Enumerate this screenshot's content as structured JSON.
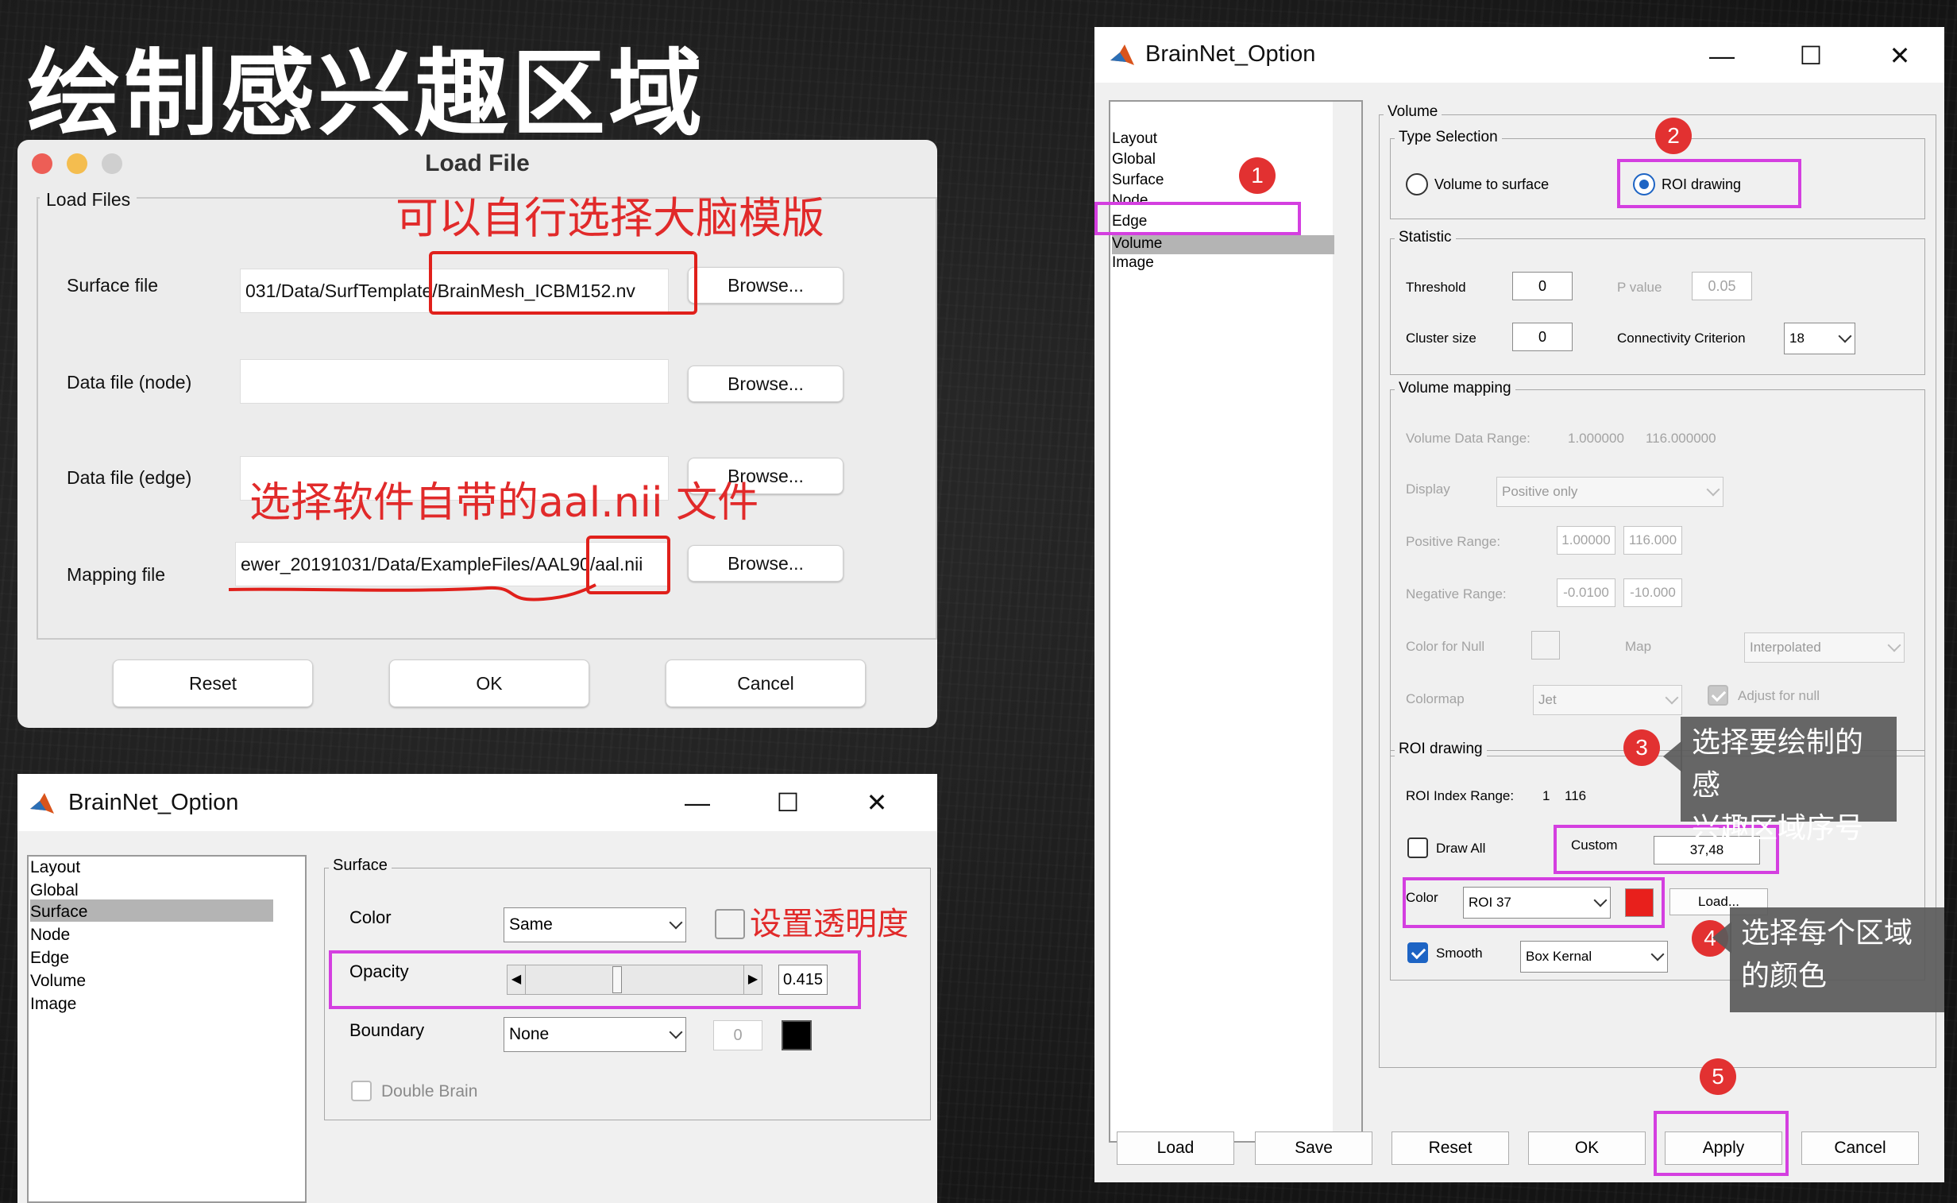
{
  "heading": "绘制感兴趣区域",
  "load_file": {
    "title": "Load File",
    "group": "Load Files",
    "rows": [
      {
        "label": "Surface file",
        "value": "031/Data/SurfTemplate/BrainMesh_ICBM152.nv",
        "button": "Browse..."
      },
      {
        "label": "Data file (node)",
        "value": "",
        "button": "Browse..."
      },
      {
        "label": "Data file (edge)",
        "value": "",
        "button": "Browse..."
      },
      {
        "label": "Mapping file",
        "value": "ewer_20191031/Data/ExampleFiles/AAL90/aal.nii",
        "button": "Browse..."
      }
    ],
    "buttons": {
      "reset": "Reset",
      "ok": "OK",
      "cancel": "Cancel"
    },
    "annotations": {
      "template": "可以自行选择大脑模版",
      "aal": "选择软件自带的aal.nii 文件"
    }
  },
  "option_small": {
    "title": "BrainNet_Option",
    "list": [
      "Layout",
      "Global",
      "Surface",
      "Node",
      "Edge",
      "Volume",
      "Image"
    ],
    "selected": "Surface",
    "panel": "Surface",
    "color_label": "Color",
    "color_value": "Same",
    "opacity_label": "Opacity",
    "opacity_value": "0.415",
    "opacity_fraction": 0.415,
    "boundary_label": "Boundary",
    "boundary_value": "None",
    "boundary_num": "0",
    "double_brain": "Double Brain",
    "annotation": "设置透明度"
  },
  "option_large": {
    "title": "BrainNet_Option",
    "list": [
      "Layout",
      "Global",
      "Surface",
      "Node",
      "Edge",
      "Volume",
      "Image"
    ],
    "selected": "Volume",
    "volume_label": "Volume",
    "type_selection": "Type Selection",
    "radio_surface": "Volume to surface",
    "radio_roi": "ROI drawing",
    "statistic": "Statistic",
    "threshold_label": "Threshold",
    "threshold_value": "0",
    "pvalue_label": "P value",
    "pvalue_value": "0.05",
    "cluster_label": "Cluster size",
    "cluster_value": "0",
    "connectivity_label": "Connectivity Criterion",
    "connectivity_value": "18",
    "volume_mapping": "Volume mapping",
    "data_range_label": "Volume Data Range:",
    "data_range_min": "1.000000",
    "data_range_max": "116.000000",
    "display_label": "Display",
    "display_value": "Positive only",
    "positive_label": "Positive Range:",
    "positive_min": "1.00000",
    "positive_max": "116.000",
    "negative_label": "Negative Range:",
    "negative_min": "-0.0100",
    "negative_max": "-10.000",
    "null_color_label": "Color for Null",
    "map_label": "Map",
    "map_value": "Interpolated",
    "colormap_label": "Colormap",
    "colormap_value": "Jet",
    "adjust_label": "Adjust for null",
    "roi_drawing": "ROI drawing",
    "roi_range_label": "ROI Index Range:",
    "roi_range_min": "1",
    "roi_range_max": "116",
    "draw_all": "Draw All",
    "custom_label": "Custom",
    "custom_value": "37,48",
    "color_label": "Color",
    "roi_value": "ROI 37",
    "roi_color": "#e8201c",
    "load_small": "Load...",
    "smooth_label": "Smooth",
    "smooth_value": "Box Kernal",
    "buttons": {
      "load": "Load",
      "save": "Save",
      "reset": "Reset",
      "ok": "OK",
      "apply": "Apply",
      "cancel": "Cancel"
    },
    "steps": [
      "1",
      "2",
      "3",
      "4",
      "5"
    ],
    "callout_3": [
      "选择要绘制的感",
      "兴趣区域序号"
    ],
    "callout_4": [
      "选择每个区域",
      "的颜色"
    ]
  }
}
